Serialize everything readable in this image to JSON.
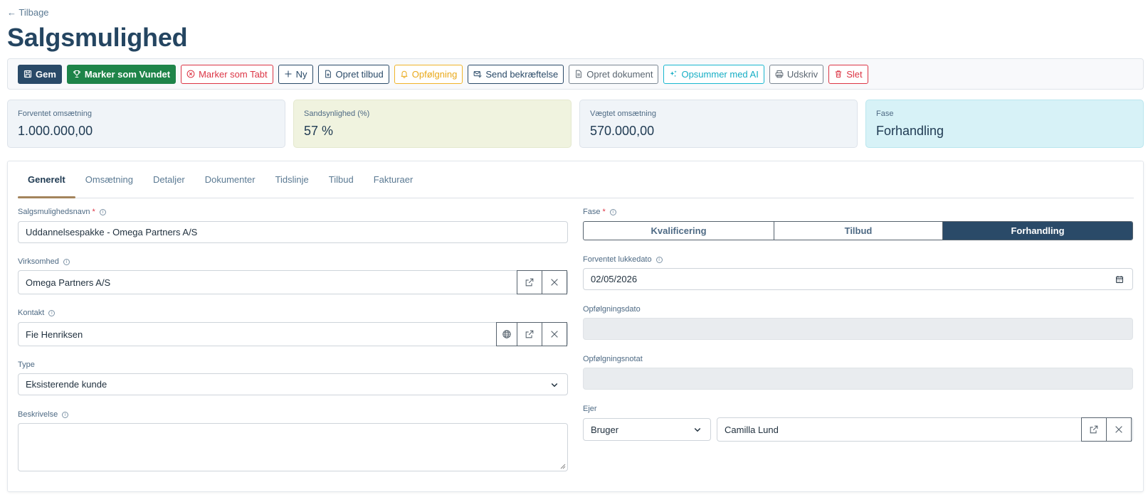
{
  "nav": {
    "back_label": "← Tilbage"
  },
  "page": {
    "title": "Salgsmulighed"
  },
  "toolbar": {
    "save": "Gem",
    "mark_won": "Marker som Vundet",
    "mark_lost": "Marker som Tabt",
    "new": "Ny",
    "create_quote": "Opret tilbud",
    "followup": "Opfølgning",
    "send_confirmation": "Send bekræftelse",
    "create_document": "Opret dokument",
    "summarize_ai": "Opsummer med AI",
    "print": "Udskriv",
    "delete": "Slet"
  },
  "stats": {
    "expected_revenue": {
      "label": "Forventet omsætning",
      "value": "1.000.000,00"
    },
    "probability": {
      "label": "Sandsynlighed (%)",
      "value": "57 %"
    },
    "weighted_revenue": {
      "label": "Vægtet omsætning",
      "value": "570.000,00"
    },
    "phase": {
      "label": "Fase",
      "value": "Forhandling"
    }
  },
  "tabs": [
    "Generelt",
    "Omsætning",
    "Detaljer",
    "Dokumenter",
    "Tidslinje",
    "Tilbud",
    "Fakturaer"
  ],
  "form": {
    "name": {
      "label": "Salgsmulighedsnavn",
      "required_mark": "*",
      "value": "Uddannelsespakke - Omega Partners A/S"
    },
    "company": {
      "label": "Virksomhed",
      "value": "Omega Partners A/S"
    },
    "contact": {
      "label": "Kontakt",
      "value": "Fie Henriksen"
    },
    "type": {
      "label": "Type",
      "value": "Eksisterende kunde"
    },
    "description": {
      "label": "Beskrivelse",
      "value": ""
    },
    "phase": {
      "label": "Fase",
      "required_mark": "*",
      "options": [
        "Kvalificering",
        "Tilbud",
        "Forhandling"
      ],
      "selected": "Forhandling"
    },
    "close_date": {
      "label": "Forventet lukkedato",
      "value": "02/05/2026"
    },
    "followup_date": {
      "label": "Opfølgningsdato",
      "value": ""
    },
    "followup_note": {
      "label": "Opfølgningsnotat",
      "value": ""
    },
    "owner": {
      "label": "Ejer",
      "type_value": "Bruger",
      "value": "Camilla Lund"
    }
  },
  "colors": {
    "primary": "#2a4a68",
    "success": "#1e8449",
    "danger": "#dc3545",
    "warning": "#f0b42a",
    "info": "#19b7cf",
    "accent_tab": "#a4845c"
  }
}
